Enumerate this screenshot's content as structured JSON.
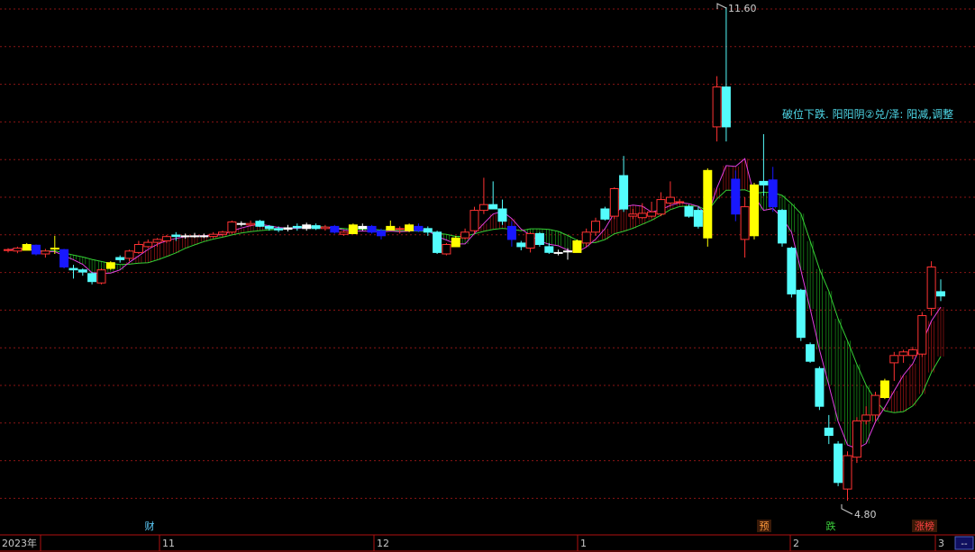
{
  "chart_data": {
    "type": "candlestick",
    "y_range": [
      4.8,
      11.6
    ],
    "annotations": {
      "high_label": "11.60",
      "low_label": "4.80",
      "signal_text": "破位下跌. 阳阳阴②兑/泽: 阳减,调整"
    },
    "bottom_markers": [
      {
        "text": "财",
        "color": "#5fd0ff"
      },
      {
        "text": "预",
        "color": "#ff9a3c"
      },
      {
        "text": "跌",
        "color": "#3cd03c"
      },
      {
        "text": "涨榜",
        "color": "#ff4040"
      }
    ],
    "time_axis": [
      "2023年",
      "11",
      "12",
      "1",
      "2",
      "3"
    ],
    "time_axis_end_button": "--",
    "candles": [
      {
        "o": 8.25,
        "h": 8.28,
        "l": 8.22,
        "c": 8.26,
        "col": "red"
      },
      {
        "o": 8.24,
        "h": 8.3,
        "l": 8.21,
        "c": 8.28,
        "col": "red"
      },
      {
        "o": 8.33,
        "h": 8.35,
        "l": 8.25,
        "c": 8.25,
        "col": "yellow"
      },
      {
        "o": 8.32,
        "h": 8.33,
        "l": 8.18,
        "c": 8.2,
        "col": "blue"
      },
      {
        "o": 8.24,
        "h": 8.27,
        "l": 8.15,
        "c": 8.2,
        "col": "red"
      },
      {
        "o": 8.28,
        "h": 8.45,
        "l": 8.2,
        "c": 8.28,
        "col": "yellow"
      },
      {
        "o": 8.26,
        "h": 8.27,
        "l": 8.0,
        "c": 8.02,
        "col": "blue"
      },
      {
        "o": 8.0,
        "h": 8.05,
        "l": 7.86,
        "c": 7.98,
        "col": "cyan"
      },
      {
        "o": 7.98,
        "h": 8.0,
        "l": 7.9,
        "c": 7.95,
        "col": "cyan"
      },
      {
        "o": 7.93,
        "h": 7.95,
        "l": 7.78,
        "c": 7.82,
        "col": "cyan"
      },
      {
        "o": 7.8,
        "h": 8.0,
        "l": 7.78,
        "c": 7.98,
        "col": "red"
      },
      {
        "o": 8.08,
        "h": 8.1,
        "l": 7.98,
        "c": 8.0,
        "col": "yellow"
      },
      {
        "o": 8.15,
        "h": 8.18,
        "l": 8.08,
        "c": 8.12,
        "col": "cyan"
      },
      {
        "o": 8.14,
        "h": 8.26,
        "l": 8.1,
        "c": 8.24,
        "col": "red"
      },
      {
        "o": 8.22,
        "h": 8.38,
        "l": 8.2,
        "c": 8.33,
        "col": "red"
      },
      {
        "o": 8.3,
        "h": 8.4,
        "l": 8.28,
        "c": 8.36,
        "col": "red"
      },
      {
        "o": 8.36,
        "h": 8.42,
        "l": 8.3,
        "c": 8.4,
        "col": "red"
      },
      {
        "o": 8.38,
        "h": 8.46,
        "l": 8.35,
        "c": 8.44,
        "col": "red"
      },
      {
        "o": 8.44,
        "h": 8.5,
        "l": 8.38,
        "c": 8.46,
        "col": "cyan"
      },
      {
        "o": 8.45,
        "h": 8.48,
        "l": 8.41,
        "c": 8.45,
        "col": "white"
      },
      {
        "o": 8.45,
        "h": 8.49,
        "l": 8.42,
        "c": 8.45,
        "col": "white"
      },
      {
        "o": 8.45,
        "h": 8.48,
        "l": 8.42,
        "c": 8.45,
        "col": "white"
      },
      {
        "o": 8.44,
        "h": 8.5,
        "l": 8.42,
        "c": 8.47,
        "col": "red"
      },
      {
        "o": 8.47,
        "h": 8.52,
        "l": 8.44,
        "c": 8.5,
        "col": "red"
      },
      {
        "o": 8.5,
        "h": 8.66,
        "l": 8.48,
        "c": 8.64,
        "col": "red"
      },
      {
        "o": 8.62,
        "h": 8.65,
        "l": 8.58,
        "c": 8.62,
        "col": "white"
      },
      {
        "o": 8.62,
        "h": 8.66,
        "l": 8.58,
        "c": 8.6,
        "col": "red"
      },
      {
        "o": 8.65,
        "h": 8.67,
        "l": 8.57,
        "c": 8.58,
        "col": "cyan"
      },
      {
        "o": 8.58,
        "h": 8.6,
        "l": 8.52,
        "c": 8.55,
        "col": "cyan"
      },
      {
        "o": 8.55,
        "h": 8.58,
        "l": 8.5,
        "c": 8.53,
        "col": "cyan"
      },
      {
        "o": 8.54,
        "h": 8.6,
        "l": 8.51,
        "c": 8.56,
        "col": "white"
      },
      {
        "o": 8.58,
        "h": 8.62,
        "l": 8.52,
        "c": 8.56,
        "col": "cyan"
      },
      {
        "o": 8.55,
        "h": 8.63,
        "l": 8.52,
        "c": 8.6,
        "col": "white"
      },
      {
        "o": 8.59,
        "h": 8.62,
        "l": 8.53,
        "c": 8.55,
        "col": "cyan"
      },
      {
        "o": 8.55,
        "h": 8.6,
        "l": 8.52,
        "c": 8.57,
        "col": "red"
      },
      {
        "o": 8.58,
        "h": 8.6,
        "l": 8.48,
        "c": 8.5,
        "col": "blue"
      },
      {
        "o": 8.47,
        "h": 8.52,
        "l": 8.45,
        "c": 8.5,
        "col": "red"
      },
      {
        "o": 8.6,
        "h": 8.62,
        "l": 8.48,
        "c": 8.48,
        "col": "yellow"
      },
      {
        "o": 8.55,
        "h": 8.62,
        "l": 8.52,
        "c": 8.58,
        "col": "white"
      },
      {
        "o": 8.58,
        "h": 8.6,
        "l": 8.48,
        "c": 8.5,
        "col": "blue"
      },
      {
        "o": 8.52,
        "h": 8.55,
        "l": 8.4,
        "c": 8.45,
        "col": "blue"
      },
      {
        "o": 8.58,
        "h": 8.66,
        "l": 8.53,
        "c": 8.53,
        "col": "yellow"
      },
      {
        "o": 8.55,
        "h": 8.58,
        "l": 8.48,
        "c": 8.55,
        "col": "red"
      },
      {
        "o": 8.6,
        "h": 8.62,
        "l": 8.5,
        "c": 8.52,
        "col": "yellow"
      },
      {
        "o": 8.58,
        "h": 8.62,
        "l": 8.5,
        "c": 8.52,
        "col": "blue"
      },
      {
        "o": 8.55,
        "h": 8.58,
        "l": 8.45,
        "c": 8.5,
        "col": "cyan"
      },
      {
        "o": 8.5,
        "h": 8.52,
        "l": 8.2,
        "c": 8.22,
        "col": "cyan"
      },
      {
        "o": 8.2,
        "h": 8.35,
        "l": 8.18,
        "c": 8.33,
        "col": "red"
      },
      {
        "o": 8.42,
        "h": 8.45,
        "l": 8.3,
        "c": 8.3,
        "col": "yellow"
      },
      {
        "o": 8.42,
        "h": 8.55,
        "l": 8.4,
        "c": 8.5,
        "col": "red"
      },
      {
        "o": 8.52,
        "h": 8.85,
        "l": 8.48,
        "c": 8.8,
        "col": "red"
      },
      {
        "o": 8.8,
        "h": 9.25,
        "l": 8.75,
        "c": 8.88,
        "col": "red"
      },
      {
        "o": 8.88,
        "h": 9.2,
        "l": 8.82,
        "c": 8.82,
        "col": "cyan"
      },
      {
        "o": 8.82,
        "h": 8.95,
        "l": 8.6,
        "c": 8.65,
        "col": "cyan"
      },
      {
        "o": 8.58,
        "h": 8.65,
        "l": 8.3,
        "c": 8.4,
        "col": "blue"
      },
      {
        "o": 8.35,
        "h": 8.38,
        "l": 8.25,
        "c": 8.3,
        "col": "cyan"
      },
      {
        "o": 8.28,
        "h": 8.5,
        "l": 8.22,
        "c": 8.48,
        "col": "red"
      },
      {
        "o": 8.48,
        "h": 8.5,
        "l": 8.3,
        "c": 8.33,
        "col": "cyan"
      },
      {
        "o": 8.3,
        "h": 8.35,
        "l": 8.2,
        "c": 8.22,
        "col": "cyan"
      },
      {
        "o": 8.22,
        "h": 8.26,
        "l": 8.18,
        "c": 8.22,
        "col": "white"
      },
      {
        "o": 8.24,
        "h": 8.28,
        "l": 8.12,
        "c": 8.24,
        "col": "white"
      },
      {
        "o": 8.38,
        "h": 8.4,
        "l": 8.22,
        "c": 8.22,
        "col": "yellow"
      },
      {
        "o": 8.35,
        "h": 8.55,
        "l": 8.3,
        "c": 8.5,
        "col": "red"
      },
      {
        "o": 8.5,
        "h": 8.7,
        "l": 8.45,
        "c": 8.65,
        "col": "red"
      },
      {
        "o": 8.68,
        "h": 8.85,
        "l": 8.66,
        "c": 8.82,
        "col": "cyan"
      },
      {
        "o": 8.72,
        "h": 9.12,
        "l": 8.68,
        "c": 9.1,
        "col": "red"
      },
      {
        "o": 9.28,
        "h": 9.55,
        "l": 8.78,
        "c": 8.82,
        "col": "cyan"
      },
      {
        "o": 8.72,
        "h": 8.82,
        "l": 8.68,
        "c": 8.75,
        "col": "red"
      },
      {
        "o": 8.7,
        "h": 8.9,
        "l": 8.68,
        "c": 8.76,
        "col": "red"
      },
      {
        "o": 8.72,
        "h": 8.92,
        "l": 8.7,
        "c": 8.78,
        "col": "red"
      },
      {
        "o": 8.75,
        "h": 9.05,
        "l": 8.72,
        "c": 8.95,
        "col": "red"
      },
      {
        "o": 8.9,
        "h": 9.2,
        "l": 8.85,
        "c": 8.98,
        "col": "red"
      },
      {
        "o": 8.92,
        "h": 8.96,
        "l": 8.88,
        "c": 8.92,
        "col": "red"
      },
      {
        "o": 8.85,
        "h": 8.88,
        "l": 8.7,
        "c": 8.72,
        "col": "cyan"
      },
      {
        "o": 8.58,
        "h": 8.85,
        "l": 8.55,
        "c": 8.8,
        "col": "cyan"
      },
      {
        "o": 9.35,
        "h": 9.38,
        "l": 8.3,
        "c": 8.42,
        "col": "yellow"
      },
      {
        "o": 9.95,
        "h": 10.65,
        "l": 9.75,
        "c": 10.5,
        "col": "red"
      },
      {
        "o": 10.5,
        "h": 11.6,
        "l": 9.75,
        "c": 9.95,
        "col": "cyan"
      },
      {
        "o": 9.23,
        "h": 9.35,
        "l": 8.65,
        "c": 8.75,
        "col": "blue"
      },
      {
        "o": 8.4,
        "h": 8.98,
        "l": 8.15,
        "c": 8.85,
        "col": "red"
      },
      {
        "o": 9.15,
        "h": 9.18,
        "l": 8.4,
        "c": 8.45,
        "col": "yellow"
      },
      {
        "o": 9.2,
        "h": 9.85,
        "l": 9.0,
        "c": 9.15,
        "col": "cyan"
      },
      {
        "o": 9.22,
        "h": 9.4,
        "l": 8.78,
        "c": 8.85,
        "col": "blue"
      },
      {
        "o": 8.8,
        "h": 8.82,
        "l": 8.3,
        "c": 8.35,
        "col": "cyan"
      },
      {
        "o": 8.28,
        "h": 8.3,
        "l": 7.6,
        "c": 7.65,
        "col": "cyan"
      },
      {
        "o": 7.7,
        "h": 7.72,
        "l": 7.0,
        "c": 7.05,
        "col": "cyan"
      },
      {
        "o": 6.95,
        "h": 6.98,
        "l": 6.7,
        "c": 6.72,
        "col": "cyan"
      },
      {
        "o": 6.62,
        "h": 6.65,
        "l": 6.05,
        "c": 6.1,
        "col": "cyan"
      },
      {
        "o": 5.8,
        "h": 5.98,
        "l": 5.58,
        "c": 5.7,
        "col": "cyan"
      },
      {
        "o": 5.58,
        "h": 5.62,
        "l": 5.0,
        "c": 5.05,
        "col": "cyan"
      },
      {
        "o": 4.96,
        "h": 5.48,
        "l": 4.8,
        "c": 5.42,
        "col": "red"
      },
      {
        "o": 5.4,
        "h": 5.95,
        "l": 5.32,
        "c": 5.9,
        "col": "red"
      },
      {
        "o": 5.9,
        "h": 6.1,
        "l": 5.85,
        "c": 5.98,
        "col": "red"
      },
      {
        "o": 5.98,
        "h": 6.3,
        "l": 5.9,
        "c": 6.25,
        "col": "red"
      },
      {
        "o": 6.45,
        "h": 6.48,
        "l": 6.2,
        "c": 6.22,
        "col": "yellow"
      },
      {
        "o": 6.7,
        "h": 6.85,
        "l": 6.45,
        "c": 6.8,
        "col": "red"
      },
      {
        "o": 6.8,
        "h": 6.88,
        "l": 6.7,
        "c": 6.85,
        "col": "red"
      },
      {
        "o": 6.8,
        "h": 6.92,
        "l": 6.75,
        "c": 6.88,
        "col": "red"
      },
      {
        "o": 6.82,
        "h": 7.4,
        "l": 6.78,
        "c": 7.35,
        "col": "red"
      },
      {
        "o": 7.45,
        "h": 8.1,
        "l": 7.35,
        "c": 8.02,
        "col": "red"
      },
      {
        "o": 7.68,
        "h": 7.85,
        "l": 7.55,
        "c": 7.62,
        "col": "cyan"
      }
    ]
  }
}
